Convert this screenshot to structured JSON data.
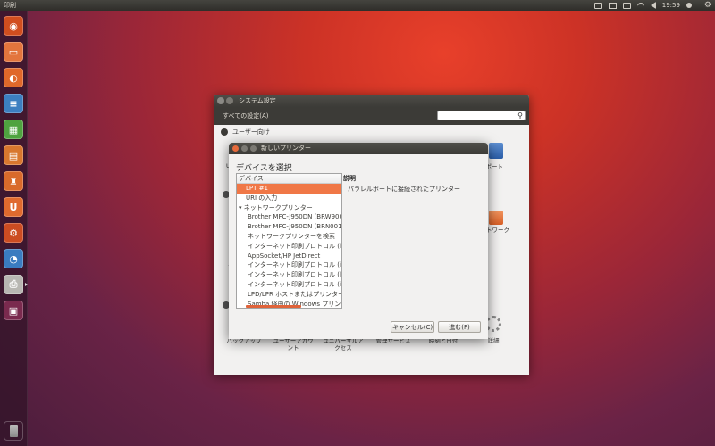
{
  "top_panel": {
    "app_title": "印刷",
    "keyboard_label": "",
    "clock": "19:59",
    "user_name": ""
  },
  "launcher": {
    "items": [
      {
        "name": "dash-home",
        "color": "#d14e1f",
        "glyph": "◉"
      },
      {
        "name": "files",
        "color": "#e3753d",
        "glyph": "▭"
      },
      {
        "name": "firefox",
        "color": "#e0682a",
        "glyph": "◐"
      },
      {
        "name": "writer",
        "color": "#3c7fc0",
        "glyph": "≡"
      },
      {
        "name": "calc",
        "color": "#4fa340",
        "glyph": "▦"
      },
      {
        "name": "impress",
        "color": "#d8772e",
        "glyph": "▤"
      },
      {
        "name": "software-center",
        "color": "#d96a2b",
        "glyph": "♜"
      },
      {
        "name": "ubuntu-one",
        "color": "#e06a2e",
        "glyph": "U"
      },
      {
        "name": "system-settings",
        "color": "#cc4c22",
        "glyph": "⚙"
      },
      {
        "name": "thunderbird",
        "color": "#3a7cc0",
        "glyph": "◔"
      },
      {
        "name": "printers",
        "color": "#b8b7b2",
        "glyph": "⎙"
      },
      {
        "name": "workspace-switcher",
        "color": "#7a2a4e",
        "glyph": "▣"
      }
    ],
    "trash": "trash"
  },
  "settings_window": {
    "title": "システム設定",
    "all_settings": "すべての設定(A)",
    "search_value": "",
    "section_personal": "ユーザー向け",
    "items": {
      "support": "サポート",
      "network": "ネットワーク",
      "backup": "バックアップ",
      "user_accounts": "ユーザーアカウント",
      "universal_access": "ユニバーサルアクセス",
      "management_service": "管理サービス",
      "time_date": "時刻と日付",
      "details": "詳細"
    },
    "partial_labels": {
      "left_u": "U",
      "left_ma": "マ"
    }
  },
  "dialog": {
    "title": "新しいプリンター",
    "heading": "デバイスを選択",
    "list_header": "デバイス",
    "devices": [
      {
        "label": "LPT #1",
        "selected": true,
        "kind": "item"
      },
      {
        "label": "URI の入力",
        "selected": false,
        "kind": "item"
      },
      {
        "label": "▾ ネットワークプリンター",
        "selected": false,
        "kind": "group"
      },
      {
        "label": "Brother MFC-J950DN (BRW9000",
        "selected": false,
        "kind": "sub"
      },
      {
        "label": "Brother MFC-J950DN (BRN0018",
        "selected": false,
        "kind": "sub"
      },
      {
        "label": "ネットワークプリンターを検索",
        "selected": false,
        "kind": "sub"
      },
      {
        "label": "インターネット印刷プロトコル (ipp",
        "selected": false,
        "kind": "sub"
      },
      {
        "label": "AppSocket/HP JetDirect",
        "selected": false,
        "kind": "sub"
      },
      {
        "label": "インターネット印刷プロトコル (ipp",
        "selected": false,
        "kind": "sub"
      },
      {
        "label": "インターネット印刷プロトコル (htt",
        "selected": false,
        "kind": "sub"
      },
      {
        "label": "インターネット印刷プロトコル (ipp",
        "selected": false,
        "kind": "sub"
      },
      {
        "label": "LPD/LPR ホストまたはプリンター",
        "selected": false,
        "kind": "sub"
      },
      {
        "label": "Samba 経由の Windows プリンタ",
        "selected": false,
        "kind": "sub"
      }
    ],
    "description_label": "説明",
    "description_text": "パラレルポートに接続されたプリンター",
    "cancel_label": "キャンセル(C)",
    "next_label": "進む(F)"
  }
}
